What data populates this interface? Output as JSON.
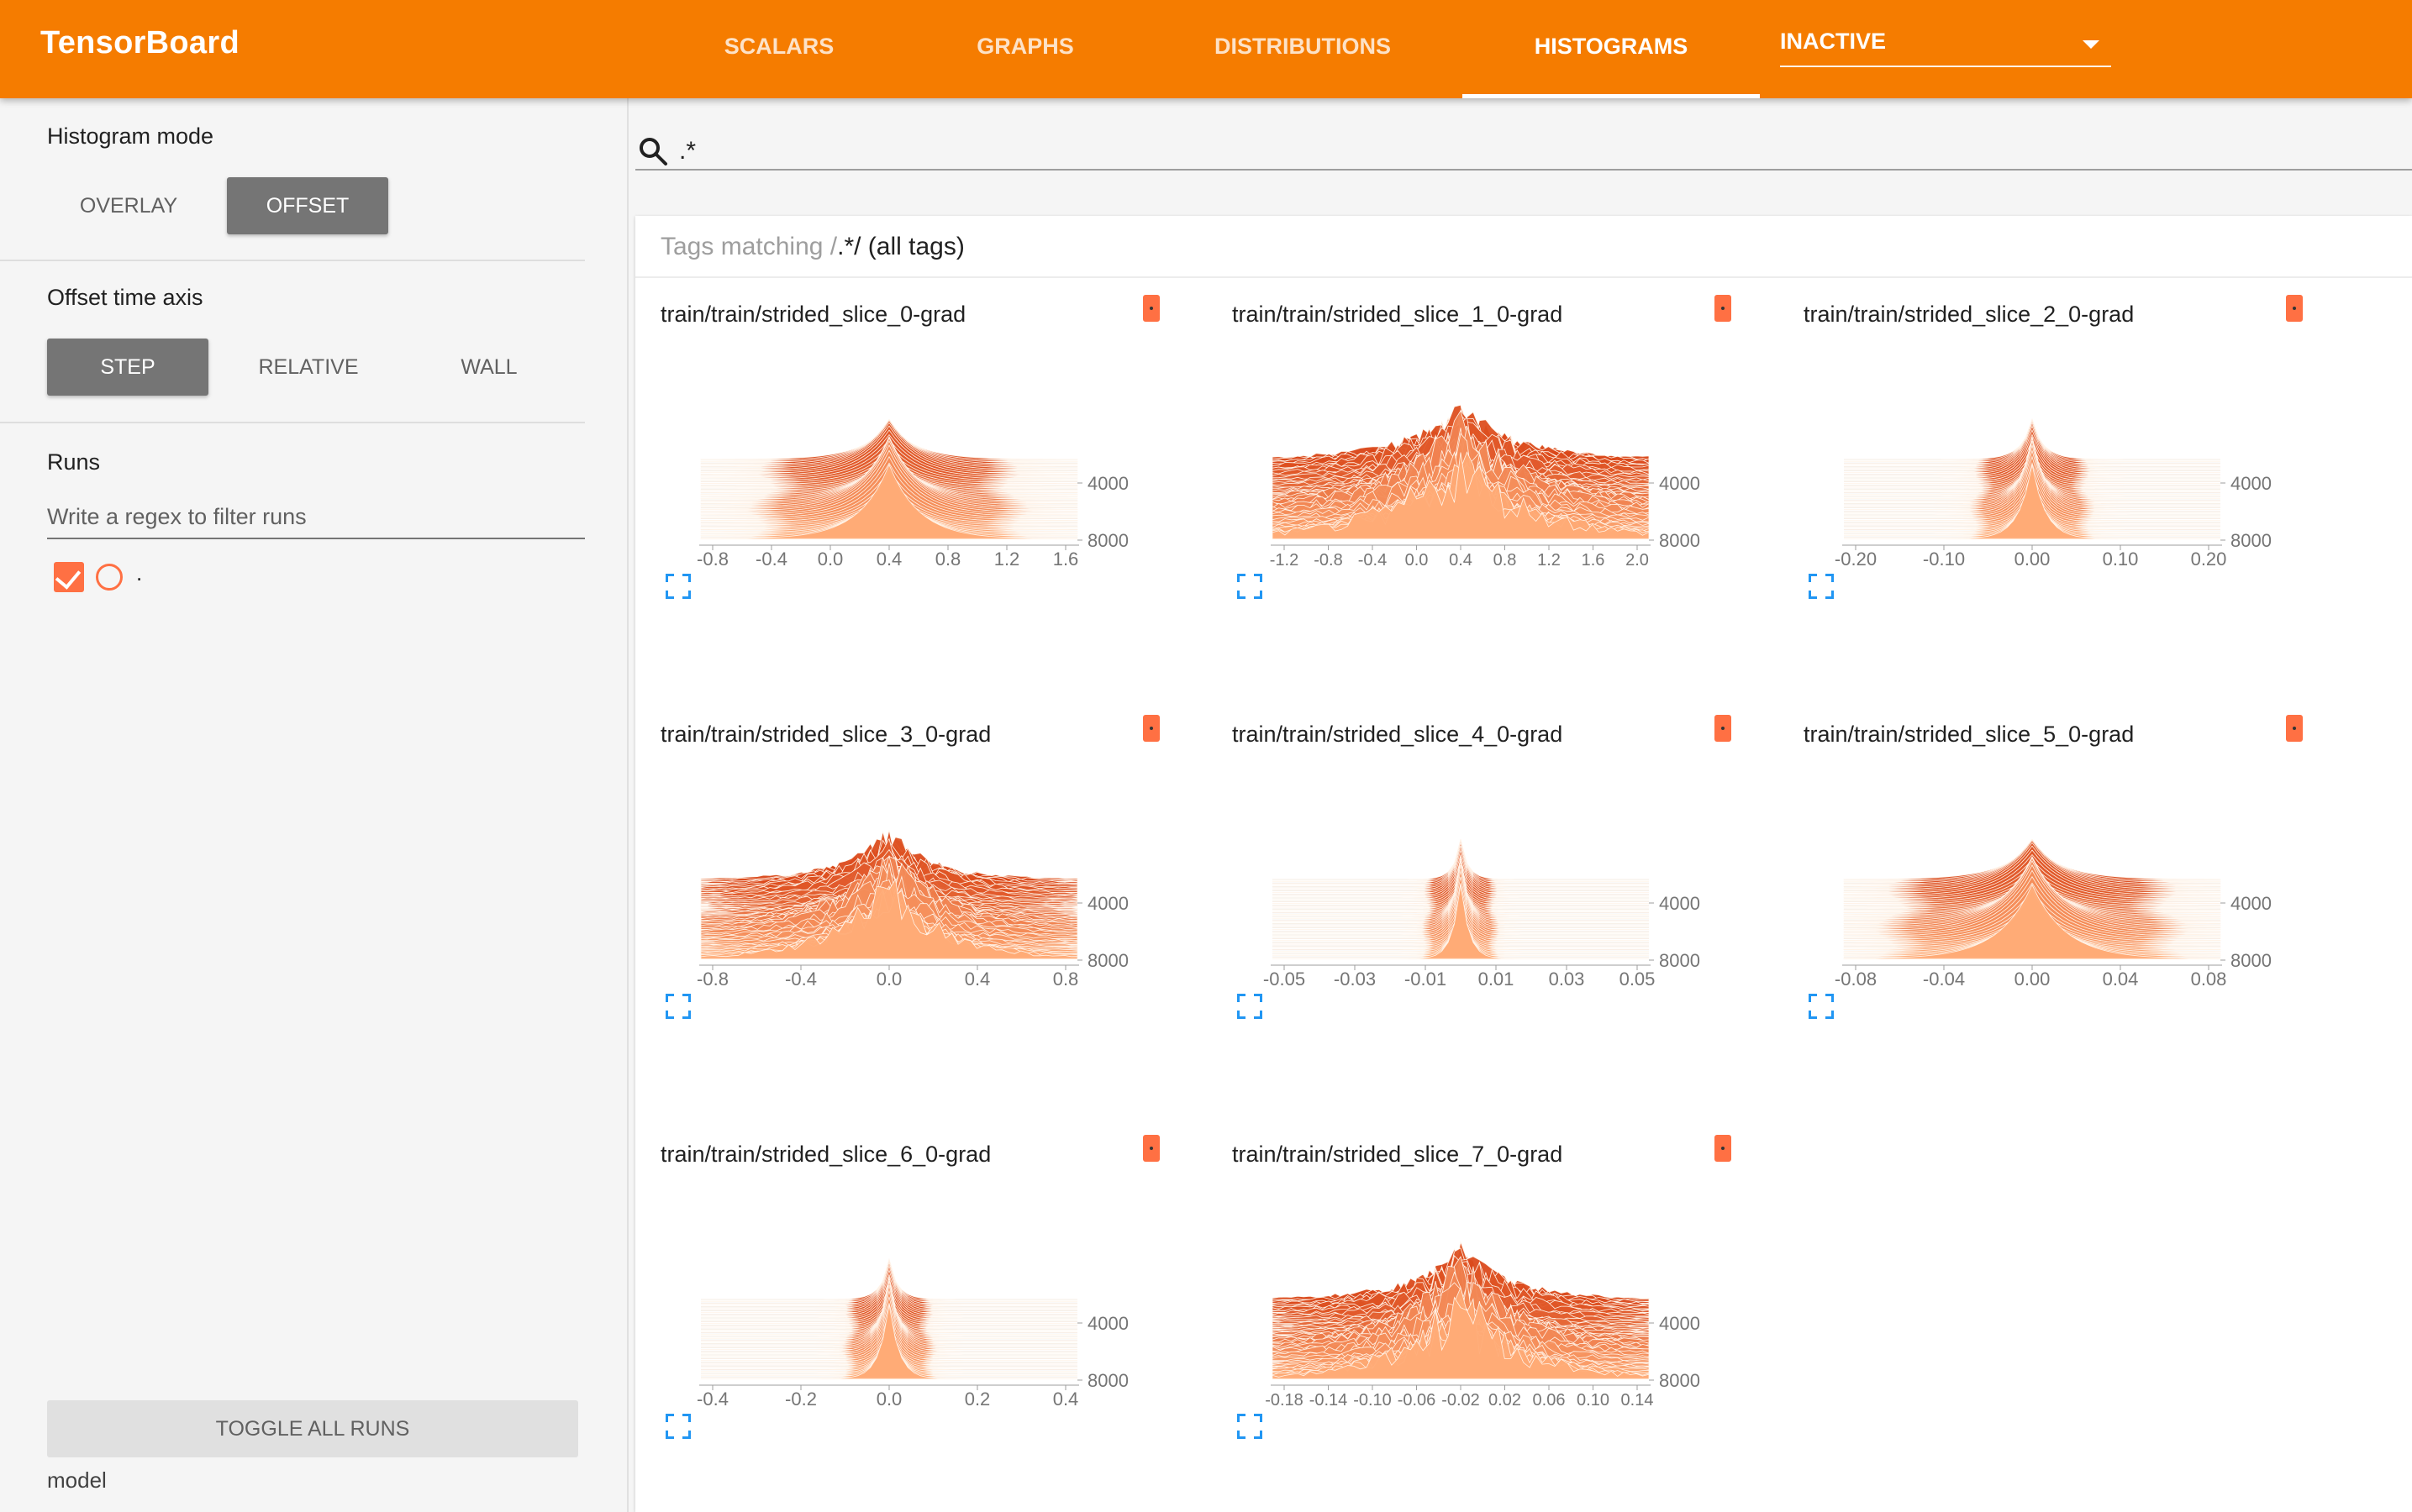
{
  "header": {
    "brand": "TensorBoard",
    "tabs": [
      {
        "label": "SCALARS",
        "active": false
      },
      {
        "label": "GRAPHS",
        "active": false
      },
      {
        "label": "DISTRIBUTIONS",
        "active": false
      },
      {
        "label": "HISTOGRAMS",
        "active": true
      }
    ],
    "inactive_label": "INACTIVE"
  },
  "sidebar": {
    "histogram_mode": {
      "title": "Histogram mode",
      "options": [
        "OVERLAY",
        "OFFSET"
      ],
      "selected": "OFFSET"
    },
    "offset_axis": {
      "title": "Offset time axis",
      "options": [
        "STEP",
        "RELATIVE",
        "WALL"
      ],
      "selected": "STEP"
    },
    "runs": {
      "title": "Runs",
      "filter_placeholder": "Write a regex to filter runs",
      "items": [
        {
          "name": ".",
          "checked": true
        }
      ]
    },
    "toggle_label": "TOGGLE ALL RUNS",
    "footer": "model"
  },
  "main": {
    "search_value": ".*",
    "card_header_prefix": "Tags matching /",
    "card_header_regex": ".*",
    "card_header_suffix": "/ (all tags)"
  },
  "colors": {
    "accent": "#f57c00",
    "histo_dark": "#d84315",
    "histo_light": "#ffcc80",
    "menu": "#ff7043",
    "expand": "#2196f3"
  },
  "chart_data": [
    {
      "type": "histogram-offset",
      "title": "train/train/strided_slice_0-grad",
      "x_ticks": [
        "-0.8",
        "-0.4",
        "0.0",
        "0.4",
        "0.8",
        "1.2",
        "1.6"
      ],
      "y_ticks": [
        "4000",
        "8000"
      ],
      "width": 0.09,
      "jitter": 0.0
    },
    {
      "type": "histogram-offset",
      "title": "train/train/strided_slice_1_0-grad",
      "x_ticks": [
        "-1.2",
        "-0.8",
        "-0.4",
        "0.0",
        "0.4",
        "0.8",
        "1.2",
        "1.6",
        "2.0"
      ],
      "y_ticks": [
        "4000",
        "8000"
      ],
      "width": 0.22,
      "jitter": 0.9
    },
    {
      "type": "histogram-offset",
      "title": "train/train/strided_slice_2_0-grad",
      "x_ticks": [
        "-0.20",
        "-0.10",
        "0.00",
        "0.10",
        "0.20"
      ],
      "y_ticks": [
        "4000",
        "8000"
      ],
      "width": 0.04,
      "jitter": 0.0
    },
    {
      "type": "histogram-offset",
      "title": "train/train/strided_slice_3_0-grad",
      "x_ticks": [
        "-0.8",
        "-0.4",
        "0.0",
        "0.4",
        "0.8"
      ],
      "y_ticks": [
        "4000",
        "8000"
      ],
      "width": 0.16,
      "jitter": 0.7
    },
    {
      "type": "histogram-offset",
      "title": "train/train/strided_slice_4_0-grad",
      "x_ticks": [
        "-0.05",
        "-0.03",
        "-0.01",
        "0.01",
        "0.03",
        "0.05"
      ],
      "y_ticks": [
        "4000",
        "8000"
      ],
      "width": 0.025,
      "jitter": 0.0
    },
    {
      "type": "histogram-offset",
      "title": "train/train/strided_slice_5_0-grad",
      "x_ticks": [
        "-0.08",
        "-0.04",
        "0.00",
        "0.04",
        "0.08"
      ],
      "y_ticks": [
        "4000",
        "8000"
      ],
      "width": 0.1,
      "jitter": 0.0
    },
    {
      "type": "histogram-offset",
      "title": "train/train/strided_slice_6_0-grad",
      "x_ticks": [
        "-0.4",
        "-0.2",
        "0.0",
        "0.2",
        "0.4"
      ],
      "y_ticks": [
        "4000",
        "8000"
      ],
      "width": 0.03,
      "jitter": 0.0
    },
    {
      "type": "histogram-offset",
      "title": "train/train/strided_slice_7_0-grad",
      "x_ticks": [
        "-0.18",
        "-0.14",
        "-0.10",
        "-0.06",
        "-0.02",
        "0.02",
        "0.06",
        "0.10",
        "0.14"
      ],
      "y_ticks": [
        "4000",
        "8000"
      ],
      "width": 0.18,
      "jitter": 1.0
    }
  ]
}
